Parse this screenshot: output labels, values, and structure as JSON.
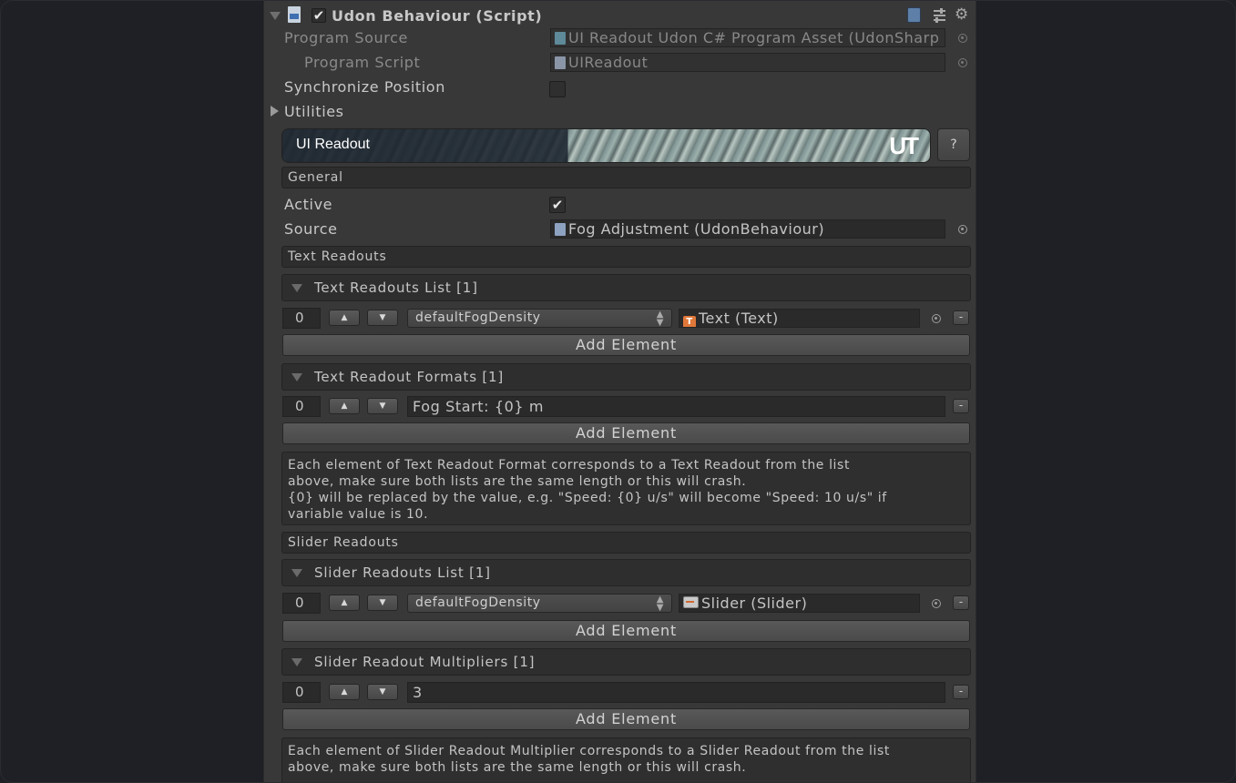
{
  "component": {
    "title": "Udon Behaviour (Script)",
    "program_source_label": "Program Source",
    "program_source_value": "UI Readout Udon C# Program Asset (UdonSharp",
    "program_script_label": "Program Script",
    "program_script_value": "UIReadout",
    "sync_label": "Synchronize Position",
    "utilities_label": "Utilities"
  },
  "banner": {
    "title": "UI Readout",
    "logo": "UT",
    "help_label": "?"
  },
  "general": {
    "section_label": "General",
    "active_label": "Active",
    "active_checked": true,
    "source_label": "Source",
    "source_value": "Fog Adjustment (UdonBehaviour)"
  },
  "text_readouts": {
    "section_label": "Text Readouts",
    "list_header": "Text Readouts List [1]",
    "items": [
      {
        "index": "0",
        "variable": "defaultFogDensity",
        "target": "Text (Text)"
      }
    ],
    "add_label": "Add Element",
    "formats_header": "Text Readout Formats [1]",
    "formats": [
      {
        "index": "0",
        "value": "Fog Start: {0} m"
      }
    ],
    "formats_add_label": "Add Element",
    "help_line1": "Each element of Text Readout Format corresponds to a Text Readout from the list",
    "help_line2": "above, make sure both lists are the same length or this will crash.",
    "help_line3": "{0} will be replaced by the value, e.g. \"Speed: {0} u/s\" will become \"Speed: 10 u/s\" if",
    "help_line4": "variable value is 10."
  },
  "slider_readouts": {
    "section_label": "Slider Readouts",
    "list_header": "Slider Readouts List [1]",
    "items": [
      {
        "index": "0",
        "variable": "defaultFogDensity",
        "target": "Slider (Slider)"
      }
    ],
    "add_label": "Add Element",
    "multipliers_header": "Slider Readout Multipliers [1]",
    "multipliers": [
      {
        "index": "0",
        "value": "3"
      }
    ],
    "multipliers_add_label": "Add Element",
    "help_line1": "Each element of Slider Readout Multiplier corresponds to a Slider Readout from the list",
    "help_line2": "above, make sure both lists are the same length or this will crash."
  },
  "glyphs": {
    "up": "▲",
    "down": "▼",
    "minus": "-",
    "dropdown_arrow": "⇕",
    "check": "✔",
    "text_icon_letter": "T"
  },
  "colors": {
    "background": "#1e2025",
    "inspector": "#383838",
    "field": "#2a2a2a",
    "text_icon": "#e0783a"
  }
}
